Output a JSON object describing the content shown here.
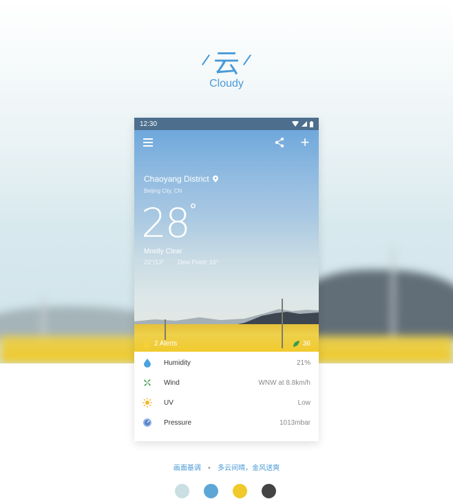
{
  "header": {
    "title_cn": "云",
    "title_en": "Cloudy"
  },
  "status_bar": {
    "time": "12:30"
  },
  "location": {
    "district": "Chaoyang District",
    "city": "Beijing City, CN"
  },
  "weather": {
    "temperature": "28",
    "degree_symbol": "°",
    "condition": "Mostly Clear",
    "hi_lo": "22°/13°",
    "dew_point": "Dew Point: 16°"
  },
  "footer": {
    "alerts": "2 Alerts",
    "aqi": "36"
  },
  "details": [
    {
      "icon": "water-drop-icon",
      "label": "Humidity",
      "value": "21%"
    },
    {
      "icon": "wind-icon",
      "label": "Wind",
      "value": "WNW at 8.8km/h"
    },
    {
      "icon": "sun-icon",
      "label": "UV",
      "value": "Low"
    },
    {
      "icon": "gauge-icon",
      "label": "Pressure",
      "value": "1013mbar"
    }
  ],
  "caption": {
    "label": "画面基调",
    "separator": "•",
    "text": "多云间晴，金风送爽"
  },
  "palette": [
    "#c9dfe2",
    "#5ea6d5",
    "#f0c92a",
    "#444444"
  ]
}
